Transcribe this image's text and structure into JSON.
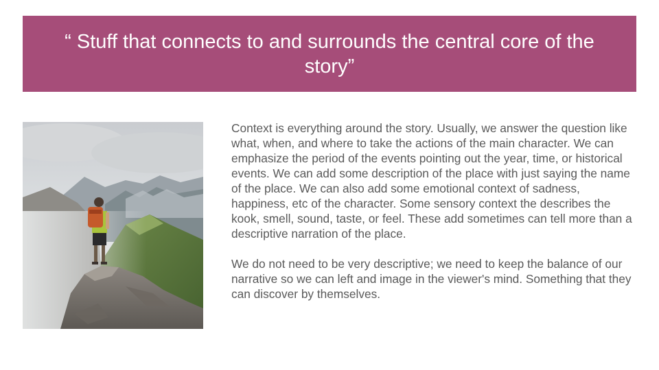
{
  "slide": {
    "title": "“ Stuff that connects to and surrounds the central core of the story”",
    "paragraphs": [
      "Context is everything around the story. Usually, we answer the question like what, when, and where to take the actions of the main character. We can emphasize the period of the events pointing out the year, time, or historical events. We can add some description of the place with just saying the name of the place. We can also add some emotional context of sadness, happiness, etc of the character. Some sensory context the describes the kook, smell, sound, taste, or feel. These add sometimes can tell more than a descriptive narration of the place.",
      "We do not need to be very descriptive; we need to keep the balance of our narrative so we can left and image in the viewer's mind. Something that they can discover by themselves."
    ]
  },
  "colors": {
    "banner": "#a64d79",
    "title_text": "#ffffff",
    "body_text": "#595959"
  }
}
